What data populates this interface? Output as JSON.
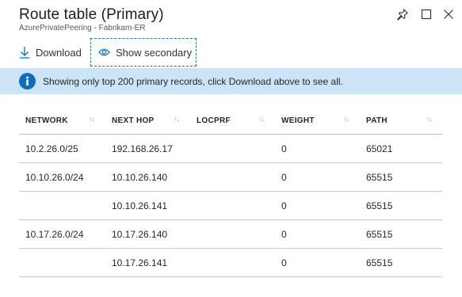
{
  "header": {
    "title": "Route table (Primary)",
    "subtitle": "AzurePrivatePeering - Fabrikam-ER"
  },
  "toolbar": {
    "download_label": "Download",
    "show_secondary_label": "Show secondary"
  },
  "info": {
    "message": "Showing only top 200 primary records, click Download above to see all."
  },
  "table": {
    "columns": [
      "NETWORK",
      "NEXT HOP",
      "LOCPRF",
      "WEIGHT",
      "PATH"
    ],
    "rows": [
      {
        "network": "10.2.26.0/25",
        "next_hop": "192.168.26.17",
        "locprf": "",
        "weight": "0",
        "path": "65021"
      },
      {
        "network": "10.10.26.0/24",
        "next_hop": "10.10.26.140",
        "locprf": "",
        "weight": "0",
        "path": "65515"
      },
      {
        "network": "",
        "next_hop": "10.10.26.141",
        "locprf": "",
        "weight": "0",
        "path": "65515"
      },
      {
        "network": "10.17.26.0/24",
        "next_hop": "10.17.26.140",
        "locprf": "",
        "weight": "0",
        "path": "65515"
      },
      {
        "network": "",
        "next_hop": "10.17.26.141",
        "locprf": "",
        "weight": "0",
        "path": "65515"
      }
    ]
  },
  "icons": {
    "pin": "pin-icon",
    "maximize": "maximize-icon",
    "close": "close-icon",
    "download": "download-icon",
    "eye": "eye-icon",
    "info": "info-icon",
    "sort": "sort-arrows-icon"
  },
  "colors": {
    "accent": "#0f6cbd",
    "info_background": "#cce4f7",
    "focus_border": "#1a73c5"
  }
}
